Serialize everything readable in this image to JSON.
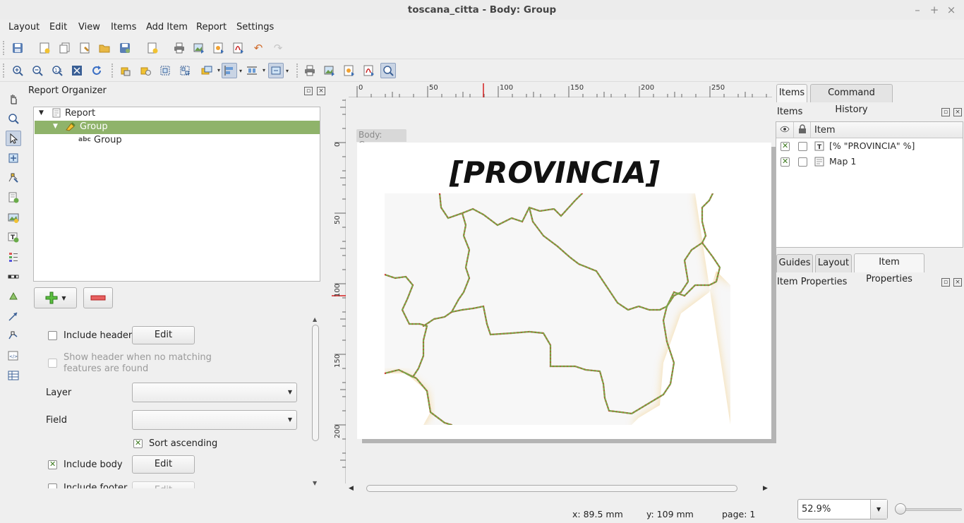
{
  "window": {
    "title": "toscana_citta - Body: Group"
  },
  "menu": [
    "Layout",
    "Edit",
    "View",
    "Items",
    "Add Item",
    "Report",
    "Settings"
  ],
  "organizer": {
    "title": "Report Organizer",
    "tree": [
      {
        "label": "Report",
        "icon": "report-icon"
      },
      {
        "label": "Group",
        "icon": "group-section-icon",
        "selected": true
      },
      {
        "label": "Group",
        "icon": "abc-field-icon"
      }
    ],
    "include_header_label": "Include header",
    "show_header_label_1": "Show header when no matching",
    "show_header_label_2": "features are found",
    "layer_label": "Layer",
    "layer_value": "",
    "field_label": "Field",
    "field_value": "",
    "sort_label": "Sort ascending",
    "include_body_label": "Include body",
    "include_footer_label": "Include footer",
    "edit_label": "Edit",
    "include_header_checked": false,
    "show_header_checked": false,
    "sort_checked": true,
    "include_body_checked": true,
    "include_footer_checked": false
  },
  "canvas": {
    "page_label": "Body: Group",
    "title_text": "[PROVINCIA]",
    "ruler_h": [
      "0",
      "50",
      "100",
      "150",
      "200",
      "250"
    ],
    "ruler_v": [
      "0",
      "50",
      "100",
      "150",
      "200"
    ]
  },
  "right_panel": {
    "tabs_top": [
      "Items",
      "Command History"
    ],
    "items_title": "Items",
    "column_item": "Item",
    "items": [
      {
        "label": "[% \"PROVINCIA\" %]",
        "visible": true,
        "locked": false,
        "icon": "label-item-icon"
      },
      {
        "label": "Map 1",
        "visible": true,
        "locked": false,
        "icon": "map-item-icon"
      }
    ],
    "tabs_bottom": [
      "Guides",
      "Layout",
      "Item Properties"
    ],
    "props_title": "Item Properties"
  },
  "status": {
    "x": "x: 89.5 mm",
    "y": "y: 109 mm",
    "page": "page: 1",
    "zoom": "52.9%"
  },
  "colors": {
    "selection": "#8fb36a",
    "boundary_red": "#d42020",
    "boundary_green": "#7aa64a",
    "halo": "#f5c15a"
  }
}
